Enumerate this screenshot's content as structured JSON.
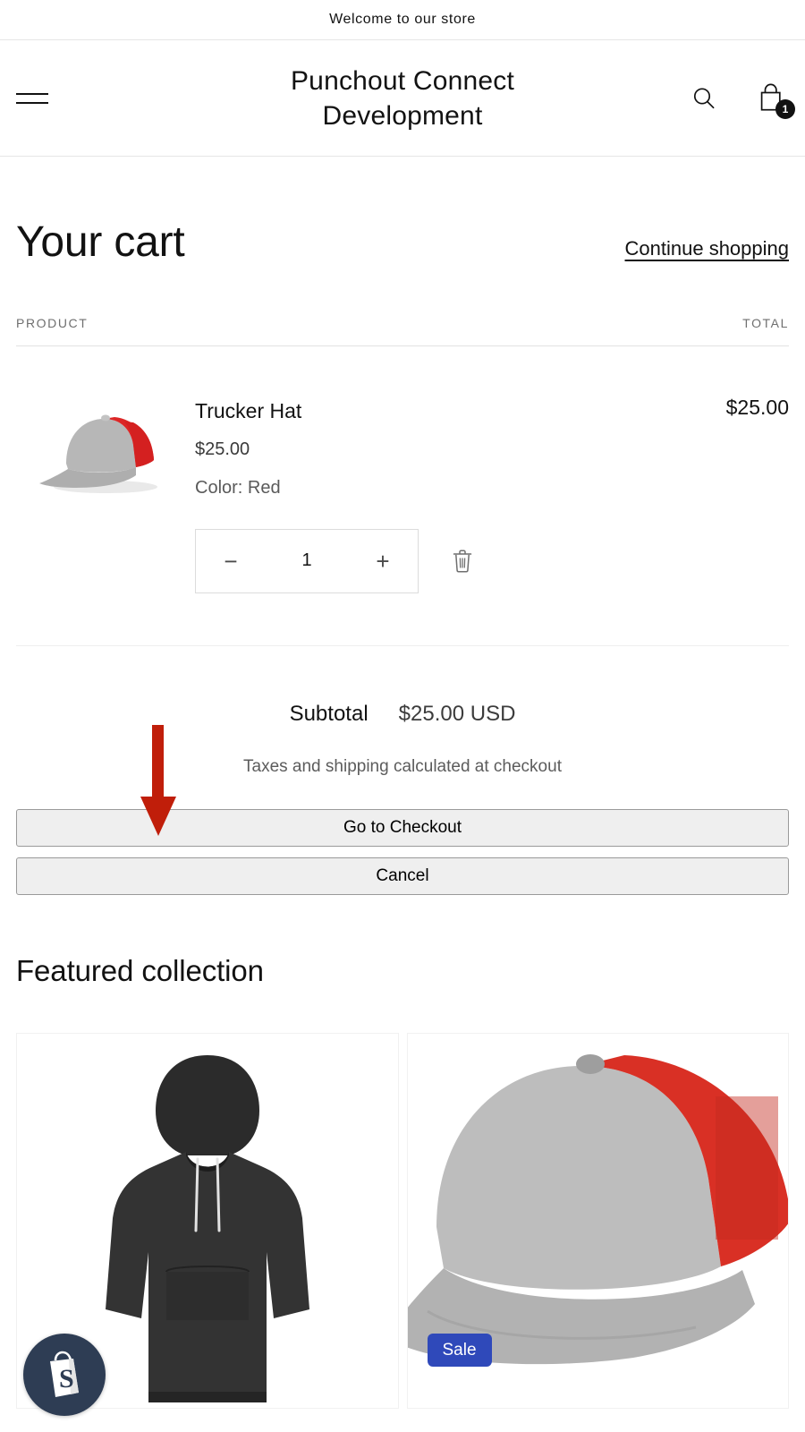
{
  "announcement": {
    "text": "Welcome to our store"
  },
  "header": {
    "shop_title": "Punchout Connect Development",
    "menu_icon": "hamburger-menu-icon",
    "search_icon": "search-icon",
    "cart_icon": "shopping-bag-icon",
    "cart_count": "1"
  },
  "cart": {
    "title": "Your cart",
    "continue_shopping": "Continue shopping",
    "columns": {
      "product": "PRODUCT",
      "total": "TOTAL"
    },
    "items": [
      {
        "name": "Trucker Hat",
        "price": "$25.00",
        "variant": "Color: Red",
        "quantity": "1",
        "decrease_label": "−",
        "increase_label": "+",
        "remove_icon": "trash-icon",
        "line_total": "$25.00",
        "image_alt": "Trucker Hat gray and red baseball cap"
      }
    ],
    "subtotal_label": "Subtotal",
    "subtotal_value": "$25.00 USD",
    "tax_note": "Taxes and shipping calculated at checkout",
    "checkout_button": "Go to Checkout",
    "cancel_button": "Cancel"
  },
  "annotation": {
    "arrow_color": "#c01e0a",
    "points_to": "Go to Checkout"
  },
  "featured": {
    "title": "Featured collection",
    "products": [
      {
        "image_alt": "Black hoodie sweatshirt",
        "badge": ""
      },
      {
        "image_alt": "Gray and red trucker cap",
        "badge": "Sale"
      }
    ]
  },
  "shopify_widget": {
    "icon": "shopify-bag-icon",
    "color": "#2e3d54"
  },
  "colors": {
    "text": "#121212",
    "muted": "#6f6f6f",
    "border": "#e6e6e6",
    "sale_badge": "#2f49ba",
    "annotation_red": "#c01e0a",
    "button_face": "#efefef"
  }
}
